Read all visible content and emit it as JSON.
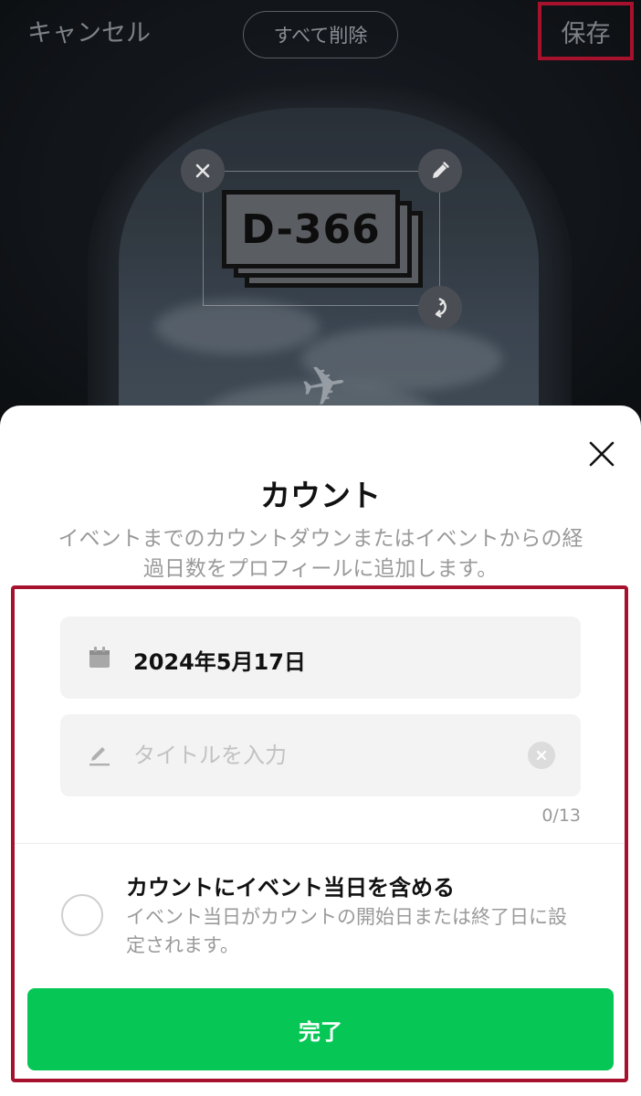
{
  "top_bar": {
    "cancel_label": "キャンセル",
    "clear_all_label": "すべて削除",
    "save_label": "保存"
  },
  "sticker": {
    "label": "D-366",
    "handles": [
      "close-icon",
      "pencil-icon",
      "rotate-icon"
    ]
  },
  "sheet": {
    "title": "カウント",
    "description": "イベントまでのカウントダウンまたはイベントからの経過日数をプロフィールに追加します。",
    "date_value": "2024年5月17日",
    "title_placeholder": "タイトルを入力",
    "title_value": "",
    "char_count": "0/13",
    "include_option": {
      "title": "カウントにイベント当日を含める",
      "description": "イベント当日がカウントの開始日または終了日に設定されます。",
      "checked": false
    },
    "done_label": "完了"
  },
  "colors": {
    "accent_green": "#06c755",
    "highlight_red": "#a6122e",
    "background_dark": "#1b2128"
  }
}
